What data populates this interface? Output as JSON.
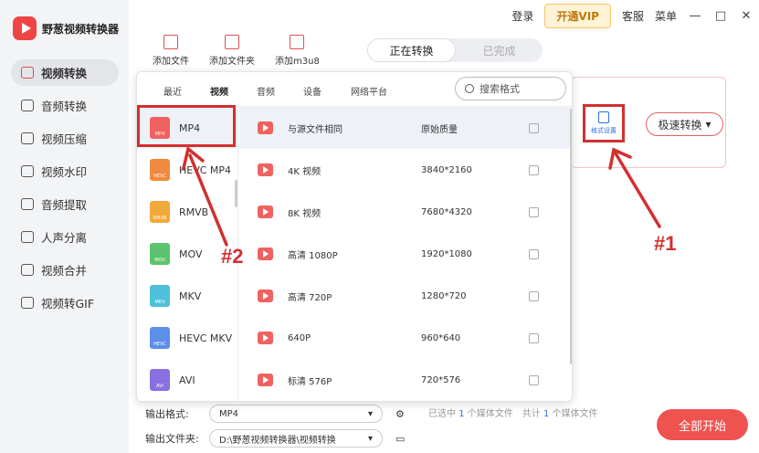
{
  "app": {
    "title": "野葱视频转换器"
  },
  "titlebar": {
    "login": "登录",
    "vip": "开通VIP",
    "service": "客服",
    "menu": "菜单",
    "min": "—",
    "restore": "□",
    "close": "✕"
  },
  "nav": [
    {
      "label": "视频转换",
      "active": true
    },
    {
      "label": "音频转换"
    },
    {
      "label": "视频压缩"
    },
    {
      "label": "视频水印"
    },
    {
      "label": "音频提取"
    },
    {
      "label": "人声分离"
    },
    {
      "label": "视频合并"
    },
    {
      "label": "视频转GIF"
    }
  ],
  "toolbar": {
    "add_file": "添加文件",
    "add_folder": "添加文件夹",
    "add_m3u8": "添加m3u8"
  },
  "segment": {
    "converting": "正在转换",
    "done": "已完成"
  },
  "card": {
    "format_settings": "格式设置",
    "speed": "极速转换"
  },
  "popup": {
    "tabs": [
      "最近",
      "视频",
      "音频",
      "设备",
      "网络平台"
    ],
    "active_tab": "视频",
    "search_placeholder": "搜索格式",
    "formats": [
      {
        "name": "MP4",
        "icon_text": "MP4",
        "color": "#f0625f"
      },
      {
        "name": "HEVC MP4",
        "icon_text": "HEVC",
        "color": "#f08a3e"
      },
      {
        "name": "RMVB",
        "icon_text": "RMVB",
        "color": "#f2a93b"
      },
      {
        "name": "MOV",
        "icon_text": "MOV",
        "color": "#5cc46e"
      },
      {
        "name": "MKV",
        "icon_text": "MKV",
        "color": "#4fc0d9"
      },
      {
        "name": "HEVC MKV",
        "icon_text": "HEVC",
        "color": "#5b8fe8"
      },
      {
        "name": "AVI",
        "icon_text": "AVI",
        "color": "#8a6fe0"
      }
    ],
    "presets": [
      {
        "name": "与源文件相同",
        "res": "原始质量"
      },
      {
        "name": "4K 视频",
        "res": "3840*2160"
      },
      {
        "name": "8K 视频",
        "res": "7680*4320"
      },
      {
        "name": "高清 1080P",
        "res": "1920*1080"
      },
      {
        "name": "高清 720P",
        "res": "1280*720"
      },
      {
        "name": "640P",
        "res": "960*640"
      },
      {
        "name": "标清 576P",
        "res": "720*576"
      }
    ]
  },
  "output": {
    "format_label": "输出格式:",
    "format_value": "MP4",
    "folder_label": "输出文件夹:",
    "folder_value": "D:\\野葱视频转换器\\视频转换"
  },
  "stats": {
    "selected_prefix": "已选中",
    "selected_count": "1",
    "selected_suffix": "个媒体文件",
    "total_prefix": "共计",
    "total_count": "1",
    "total_suffix": "个媒体文件"
  },
  "start_label": "全部开始",
  "annotations": {
    "one": "#1",
    "two": "#2"
  },
  "colors": {
    "accent": "#ef5350",
    "highlight": "#d32f2f",
    "link": "#2f6fd6"
  }
}
